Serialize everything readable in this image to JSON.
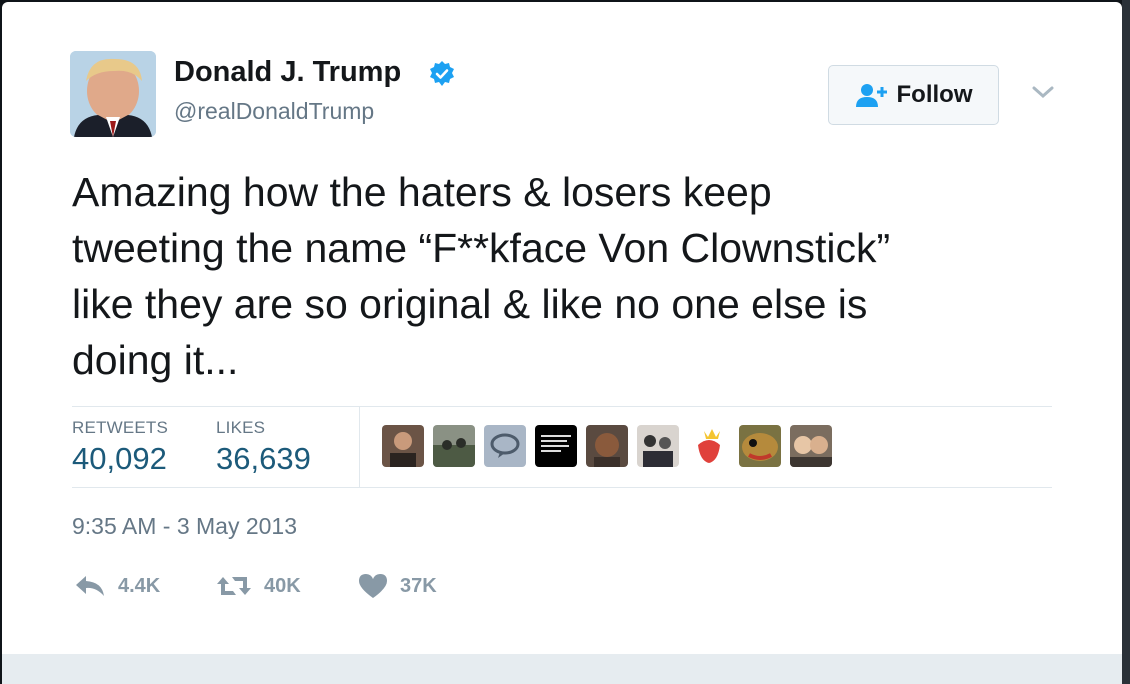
{
  "tweet": {
    "author_name": "Donald J. Trump",
    "handle": "@realDonaldTrump",
    "follow_label": "Follow",
    "text": "Amazing how the haters & losers keep\ntweeting the name “F**kface Von Clownstick”\nlike they are so original & like no one else is\ndoing it...",
    "timestamp": "9:35 AM - 3 May 2013"
  },
  "stats": {
    "retweets_label": "RETWEETS",
    "retweets_value": "40,092",
    "likes_label": "LIKES",
    "likes_value": "36,639"
  },
  "actions": {
    "reply_count": "4.4K",
    "retweet_count": "40K",
    "like_count": "37K"
  },
  "colors": {
    "verified": "#1da1f2",
    "stat_value": "#1c5a7a",
    "muted": "#657786",
    "action": "#8899a6"
  },
  "icons": [
    "verified-badge-icon",
    "follow-person-icon",
    "chevron-down-icon",
    "reply-icon",
    "retweet-icon",
    "heart-icon"
  ]
}
